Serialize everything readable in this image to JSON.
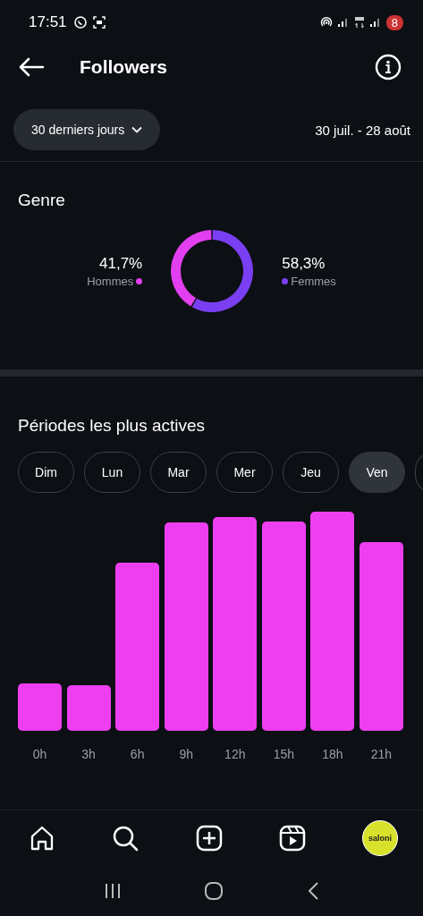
{
  "status_bar": {
    "time": "17:51",
    "battery": "8"
  },
  "header": {
    "title": "Followers"
  },
  "filter": {
    "range_button": "30 derniers jours",
    "date_range": "30 juil. - 28 août"
  },
  "genre": {
    "title": "Genre",
    "items": [
      {
        "value": "41,7%",
        "color": "#e23ff0"
      },
      {
        "value": "58,3%",
        "color": "#7a3ff2"
      }
    ],
    "chart_data": {
      "type": "donut",
      "categories": [
        "Hommes",
        "Femmes"
      ],
      "values": [
        41.7,
        58.3
      ]
    }
  },
  "active_periods": {
    "title": "Périodes les plus actives",
    "days": [
      {
        "label": "Dim",
        "selected": false
      },
      {
        "label": "Lun",
        "selected": false
      },
      {
        "label": "Mar",
        "selected": false
      },
      {
        "label": "Mer",
        "selected": false
      },
      {
        "label": "Jeu",
        "selected": false
      },
      {
        "label": "Ven",
        "selected": true
      }
    ],
    "hours": [
      "0h",
      "3h",
      "6h",
      "9h",
      "12h",
      "15h",
      "18h",
      "21h"
    ]
  },
  "nav": {
    "avatar_text": "saloni"
  }
}
